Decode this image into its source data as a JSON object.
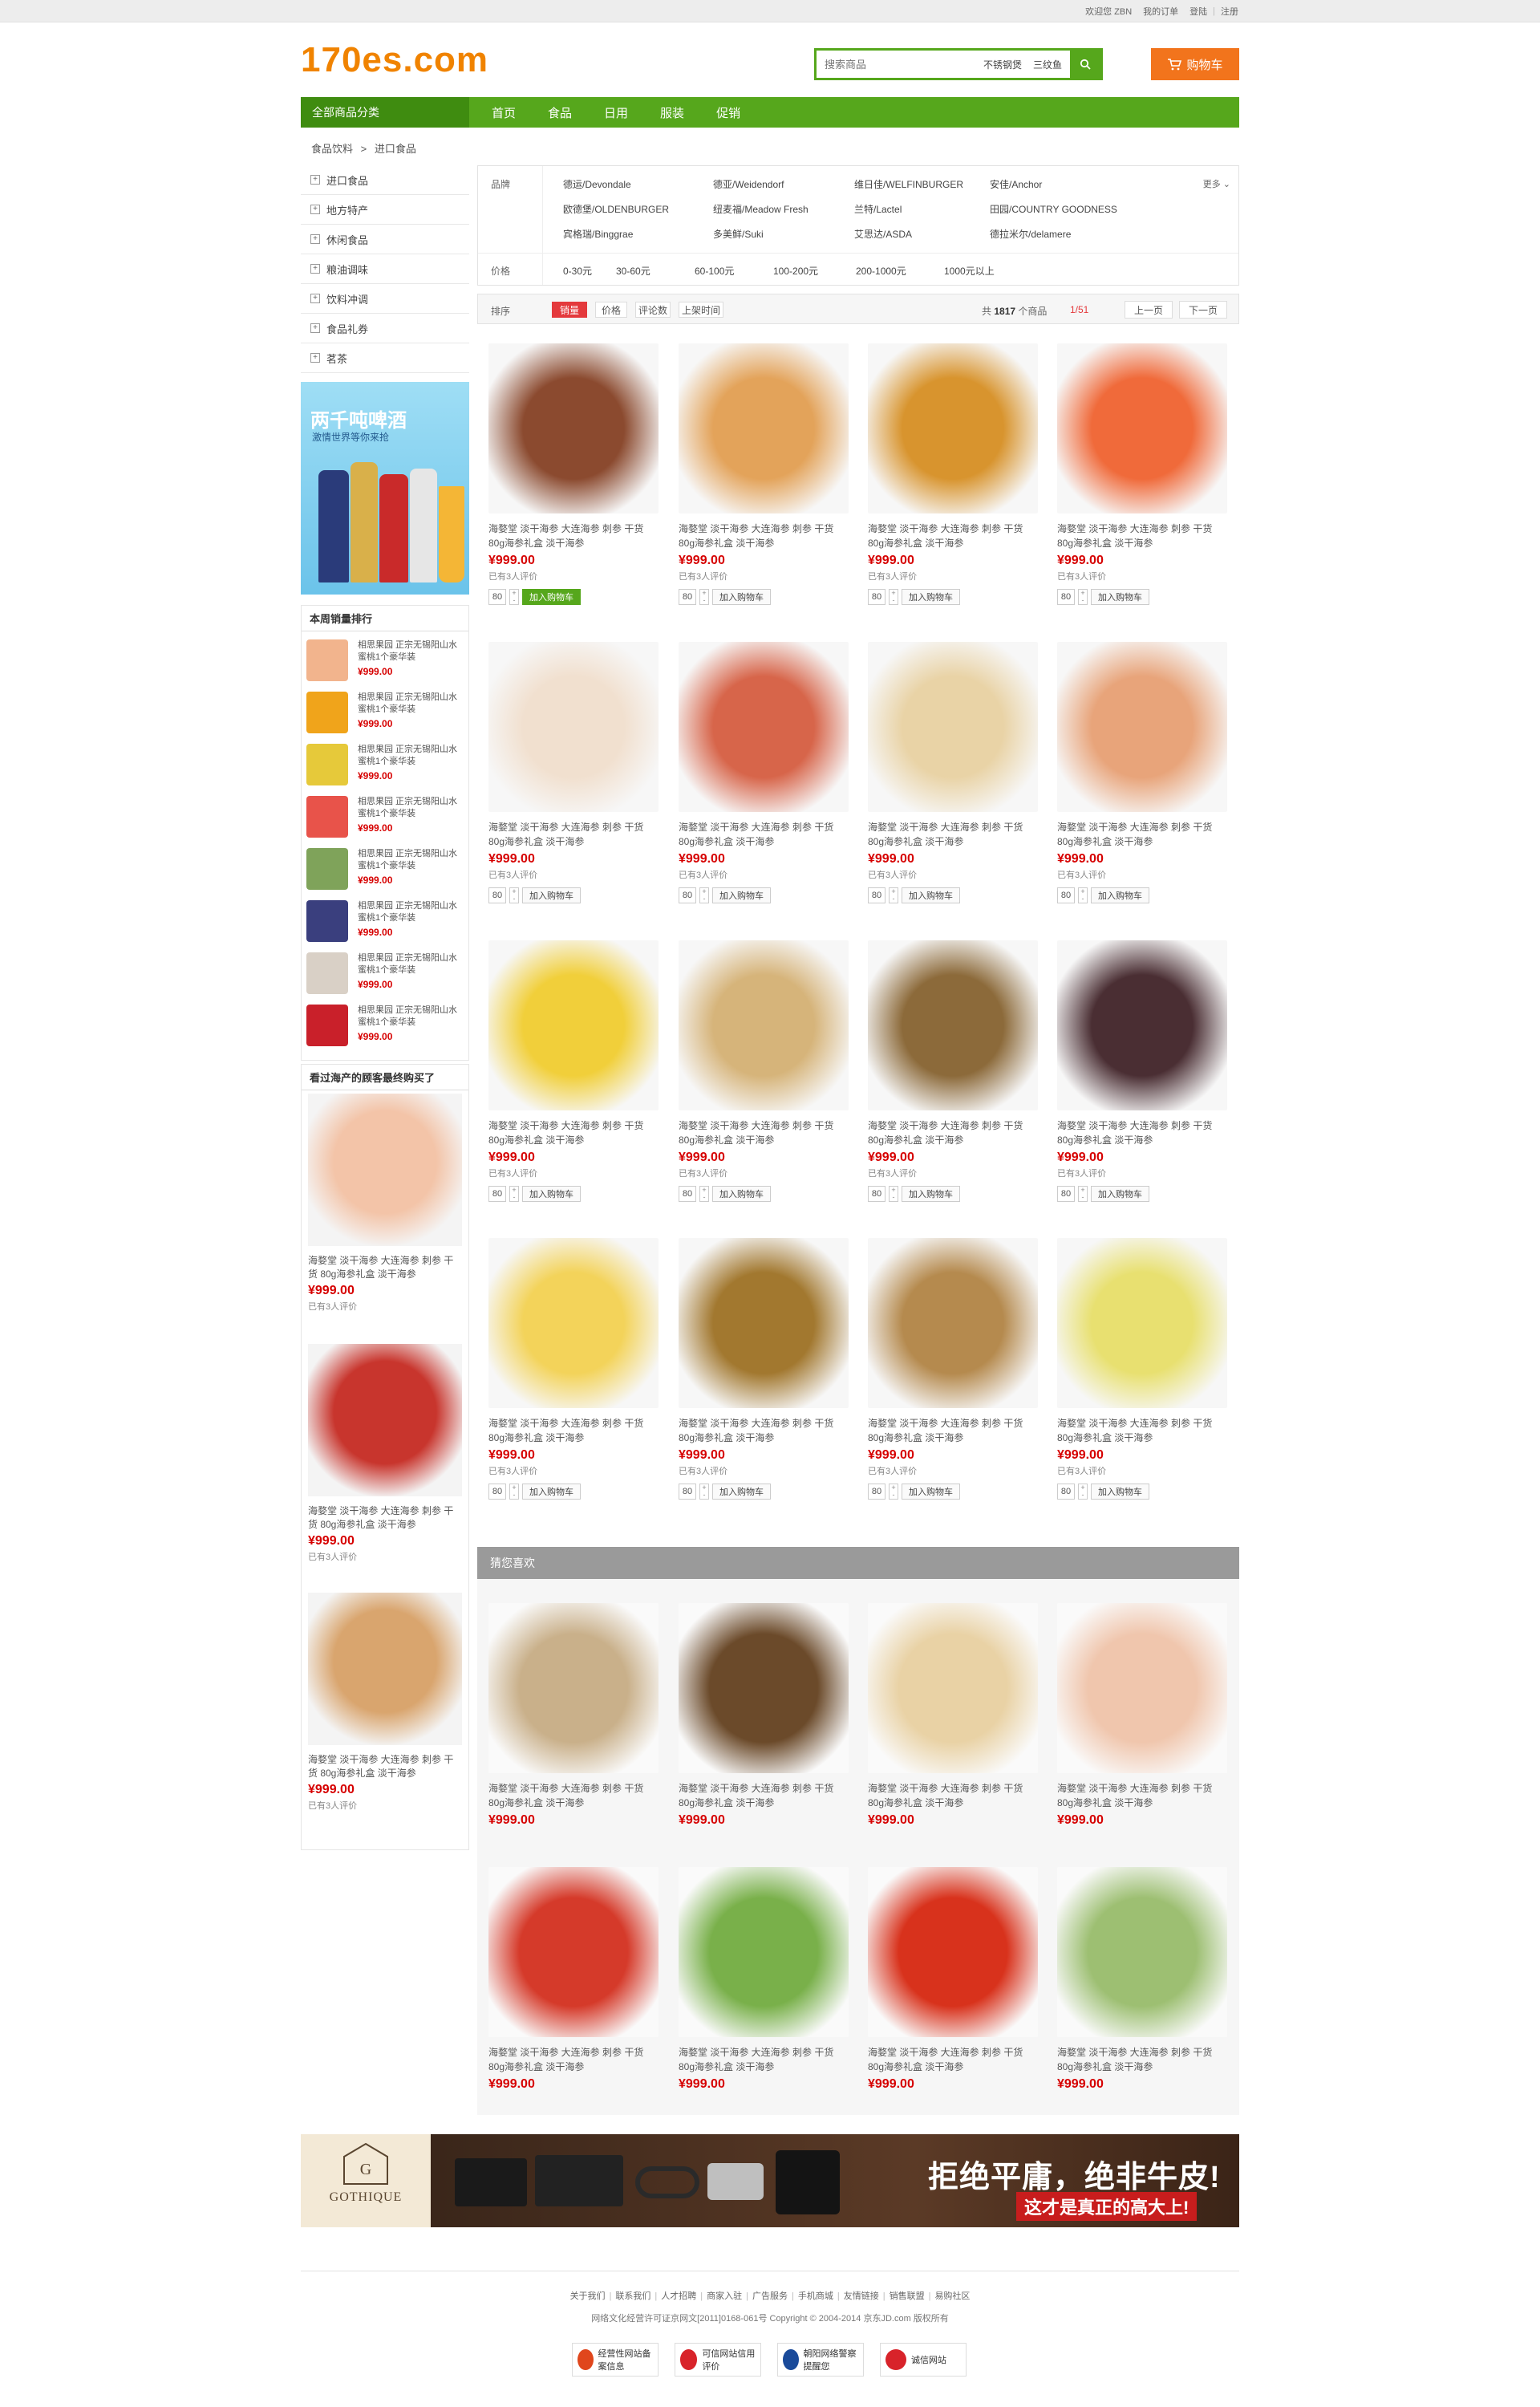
{
  "topbar": {
    "welcome": "欢迎您 ZBN",
    "orders": "我的订单",
    "login": "登陆",
    "register": "注册"
  },
  "logo": "170es.com",
  "search": {
    "placeholder": "搜索商品",
    "hot": [
      "不锈钢煲",
      "三纹鱼"
    ]
  },
  "cart": {
    "label": "购物车"
  },
  "nav": {
    "all_categories": "全部商品分类",
    "items": [
      "首页",
      "食品",
      "日用",
      "服装",
      "促销"
    ]
  },
  "breadcrumb": {
    "root": "食品饮料",
    "sep": ">",
    "current": "进口食品"
  },
  "categories": [
    "进口食品",
    "地方特产",
    "休闲食品",
    "粮油调味",
    "饮料冲调",
    "食品礼券",
    "茗茶"
  ],
  "promo": {
    "title": "两千吨啤酒",
    "subtitle": "激情世界等你来抢"
  },
  "ranking": {
    "title": "本周销量排行",
    "items": [
      {
        "title": "相思果园 正宗无锡阳山水蜜桃1个豪华装",
        "price": "¥999.00",
        "color": "#f2b48d"
      },
      {
        "title": "相思果园 正宗无锡阳山水蜜桃1个豪华装",
        "price": "¥999.00",
        "color": "#f0a41b"
      },
      {
        "title": "相思果园 正宗无锡阳山水蜜桃1个豪华装",
        "price": "¥999.00",
        "color": "#e6c93a"
      },
      {
        "title": "相思果园 正宗无锡阳山水蜜桃1个豪华装",
        "price": "¥999.00",
        "color": "#e8534a"
      },
      {
        "title": "相思果园 正宗无锡阳山水蜜桃1个豪华装",
        "price": "¥999.00",
        "color": "#7fa35a"
      },
      {
        "title": "相思果园 正宗无锡阳山水蜜桃1个豪华装",
        "price": "¥999.00",
        "color": "#3a3f7e"
      },
      {
        "title": "相思果园 正宗无锡阳山水蜜桃1个豪华装",
        "price": "¥999.00",
        "color": "#d9d0c6"
      },
      {
        "title": "相思果园 正宗无锡阳山水蜜桃1个豪华装",
        "price": "¥999.00",
        "color": "#c9202a"
      }
    ]
  },
  "viewed": {
    "title": "看过海产的顾客最终购买了",
    "items": [
      {
        "title": "海婺堂 淡干海参 大连海参 刺参 干货 80g海参礼盒 淡干海参",
        "price": "¥999.00",
        "reviews": "已有3人评价",
        "color": "#f3c4a8"
      },
      {
        "title": "海婺堂 淡干海参 大连海参 刺参 干货 80g海参礼盒 淡干海参",
        "price": "¥999.00",
        "reviews": "已有3人评价",
        "color": "#c8352d"
      },
      {
        "title": "海婺堂 淡干海参 大连海参 刺参 干货 80g海参礼盒 淡干海参",
        "price": "¥999.00",
        "reviews": "已有3人评价",
        "color": "#d9a56e"
      }
    ]
  },
  "filter": {
    "brand_label": "品牌",
    "price_label": "价格",
    "more": "更多",
    "brands": [
      "德运/Devondale",
      "德亚/Weidendorf",
      "维日佳/WELFINBURGER",
      "安佳/Anchor",
      "欧德堡/OLDENBURGER",
      "纽麦福/Meadow Fresh",
      "兰特/Lactel",
      "田园/COUNTRY GOODNESS",
      "宾格瑞/Binggrae",
      "多美鲜/Suki",
      "艾思达/ASDA",
      "德拉米尔/delamere"
    ],
    "prices": [
      "0-30元",
      "30-60元",
      "60-100元",
      "100-200元",
      "200-1000元",
      "1000元以上"
    ]
  },
  "sort": {
    "label": "排序",
    "options": [
      "销量",
      "价格",
      "评论数",
      "上架时间"
    ],
    "total_prefix": "共",
    "total": "1817",
    "total_suffix": "个商品",
    "page": "1/51",
    "prev": "上一页",
    "next": "下一页"
  },
  "product_common": {
    "title": "海婺堂 淡干海参 大连海参 刺参 干货 80g海参礼盒 淡干海参",
    "price": "¥999.00",
    "reviews": "已有3人评价",
    "qty": "80",
    "add_cart": "加入购物车"
  },
  "products": [
    {
      "color": "#8b4a2f"
    },
    {
      "color": "#e3a35a"
    },
    {
      "color": "#d8942e"
    },
    {
      "color": "#f06a3a"
    },
    {
      "color": "#f1e0cf"
    },
    {
      "color": "#d7654a"
    },
    {
      "color": "#e9d3a6"
    },
    {
      "color": "#e8a47a"
    },
    {
      "color": "#f1cf3a"
    },
    {
      "color": "#d6b47a"
    },
    {
      "color": "#8c6a3a"
    },
    {
      "color": "#4a2e33"
    },
    {
      "color": "#f3d35a"
    },
    {
      "color": "#a2782f"
    },
    {
      "color": "#b58a4e"
    },
    {
      "color": "#e8e070"
    }
  ],
  "guess": {
    "title": "猜您喜欢",
    "items": [
      {
        "color": "#c9b08a"
      },
      {
        "color": "#6b4a2a"
      },
      {
        "color": "#e9d2a5"
      },
      {
        "color": "#f0c6ad"
      },
      {
        "color": "#d53a2a"
      },
      {
        "color": "#79b04a"
      },
      {
        "color": "#d8321c"
      },
      {
        "color": "#9dbf72"
      }
    ]
  },
  "banner": {
    "brand": "GOTHIQUE",
    "slogan": "拒绝平庸，绝非牛皮!",
    "sub": "这才是真正的高大上!"
  },
  "footer": {
    "links": [
      "关于我们",
      "联系我们",
      "人才招聘",
      "商家入驻",
      "广告服务",
      "手机商城",
      "友情链接",
      "销售联盟",
      "易购社区"
    ],
    "copyright": "网络文化经营许可证京网文[2011]0168-061号 Copyright © 2004-2014 京东JD.com 版权所有",
    "badges": [
      "经营性网站备案信息",
      "可信网站信用评价",
      "朝阳网络警察提醒您",
      "诚信网站"
    ]
  },
  "colors": {
    "green": "#56a71c",
    "orange": "#f2741c",
    "price": "#d60000"
  }
}
